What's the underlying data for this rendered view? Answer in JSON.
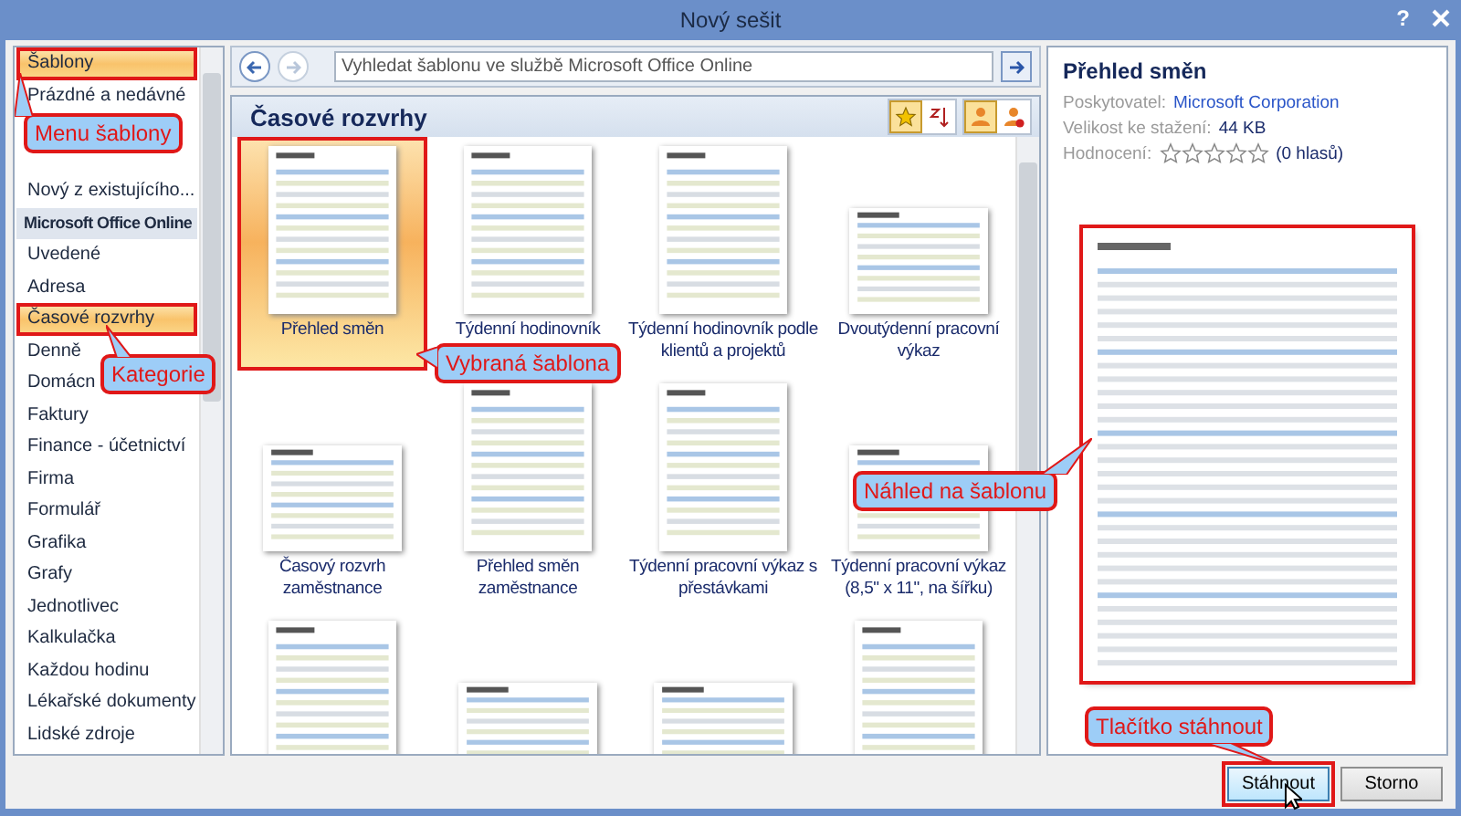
{
  "window": {
    "title": "Nový sešit",
    "help": "?"
  },
  "sidebar": {
    "items": [
      {
        "label": "Šablony",
        "kind": "item",
        "selected": true,
        "highlighted": true
      },
      {
        "label": "Prázdné a nedávné",
        "kind": "item",
        "selected": false,
        "highlighted": false
      },
      {
        "kind": "covered"
      },
      {
        "kind": "covered"
      },
      {
        "label": "Nový z existujícího...",
        "kind": "item",
        "selected": false,
        "highlighted": false
      },
      {
        "label": "Microsoft Office Online",
        "kind": "header"
      },
      {
        "label": "Uvedené",
        "kind": "item",
        "selected": false,
        "highlighted": false
      },
      {
        "label": "Adresa",
        "kind": "item",
        "selected": false,
        "highlighted": false
      },
      {
        "label": "Časové rozvrhy",
        "kind": "item",
        "selected": true,
        "highlighted": true
      },
      {
        "label": "Denně",
        "kind": "item",
        "selected": false,
        "highlighted": false
      },
      {
        "label": "Domácn",
        "kind": "item",
        "selected": false,
        "highlighted": false
      },
      {
        "label": "Faktury",
        "kind": "item",
        "selected": false,
        "highlighted": false
      },
      {
        "label": "Finance - účetnictví",
        "kind": "item",
        "selected": false,
        "highlighted": false
      },
      {
        "label": "Firma",
        "kind": "item",
        "selected": false,
        "highlighted": false
      },
      {
        "label": "Formulář",
        "kind": "item",
        "selected": false,
        "highlighted": false
      },
      {
        "label": "Grafika",
        "kind": "item",
        "selected": false,
        "highlighted": false
      },
      {
        "label": "Grafy",
        "kind": "item",
        "selected": false,
        "highlighted": false
      },
      {
        "label": "Jednotlivec",
        "kind": "item",
        "selected": false,
        "highlighted": false
      },
      {
        "label": "Kalkulačka",
        "kind": "item",
        "selected": false,
        "highlighted": false
      },
      {
        "label": "Každou hodinu",
        "kind": "item",
        "selected": false,
        "highlighted": false
      },
      {
        "label": "Lékařské dokumenty",
        "kind": "item",
        "selected": false,
        "highlighted": false
      },
      {
        "label": "Lidské zdroje",
        "kind": "item",
        "selected": false,
        "highlighted": false
      }
    ]
  },
  "search": {
    "placeholder": "Vyhledat šablonu ve službě Microsoft Office Online"
  },
  "gallery": {
    "title": "Časové rozvrhy",
    "sort_buttons": [
      {
        "selected": true
      },
      {
        "selected": false
      }
    ],
    "filter_buttons": [
      {
        "selected": true
      },
      {
        "selected": false
      }
    ],
    "templates": [
      {
        "label": "Přehled směn",
        "kind": "portrait",
        "selected": true,
        "highlighted": true
      },
      {
        "label": "Týdenní hodinovník",
        "kind": "portrait",
        "selected": false,
        "highlighted": false
      },
      {
        "label": "Týdenní hodinovník podle klientů a projektů",
        "kind": "portrait",
        "selected": false,
        "highlighted": false
      },
      {
        "label": "Dvoutýdenní pracovní výkaz",
        "kind": "landscape",
        "selected": false,
        "highlighted": false
      },
      {
        "label": "Časový rozvrh zaměstnance",
        "kind": "landscape",
        "selected": false,
        "highlighted": false
      },
      {
        "label": "Přehled směn zaměstnance",
        "kind": "portrait",
        "selected": false,
        "highlighted": false
      },
      {
        "label": "Týdenní pracovní výkaz s přestávkami",
        "kind": "portrait",
        "selected": false,
        "highlighted": false
      },
      {
        "label": "Týdenní pracovní výkaz (8,5\" x 11\", na šířku)",
        "kind": "landscape",
        "selected": false,
        "highlighted": false
      },
      {
        "kind": "portrait",
        "selected": false,
        "highlighted": false
      },
      {
        "kind": "landscape",
        "selected": false,
        "highlighted": false
      },
      {
        "kind": "landscape",
        "selected": false,
        "highlighted": false
      },
      {
        "kind": "portrait",
        "selected": false,
        "highlighted": false
      }
    ]
  },
  "details": {
    "title": "Přehled směn",
    "fields": [
      {
        "label": "Poskytovatel:",
        "value": "Microsoft Corporation",
        "kind": "link"
      },
      {
        "label": "Velikost ke stažení:",
        "value": "44 KB",
        "kind": "text"
      },
      {
        "label": "Hodnocení:",
        "value": "(0 hlasů)",
        "kind": "rating",
        "stars": 0
      }
    ],
    "preview_highlighted": true
  },
  "buttons": [
    {
      "label": "Stáhnout",
      "highlighted": true
    },
    {
      "label": "Storno",
      "highlighted": false
    }
  ],
  "callouts": [
    {
      "text": "Menu šablony"
    },
    {
      "text": "Kategorie"
    },
    {
      "text": "Vybraná šablona"
    },
    {
      "text": "Náhled na šablonu"
    },
    {
      "text": "Tlačítko stáhnout"
    }
  ]
}
